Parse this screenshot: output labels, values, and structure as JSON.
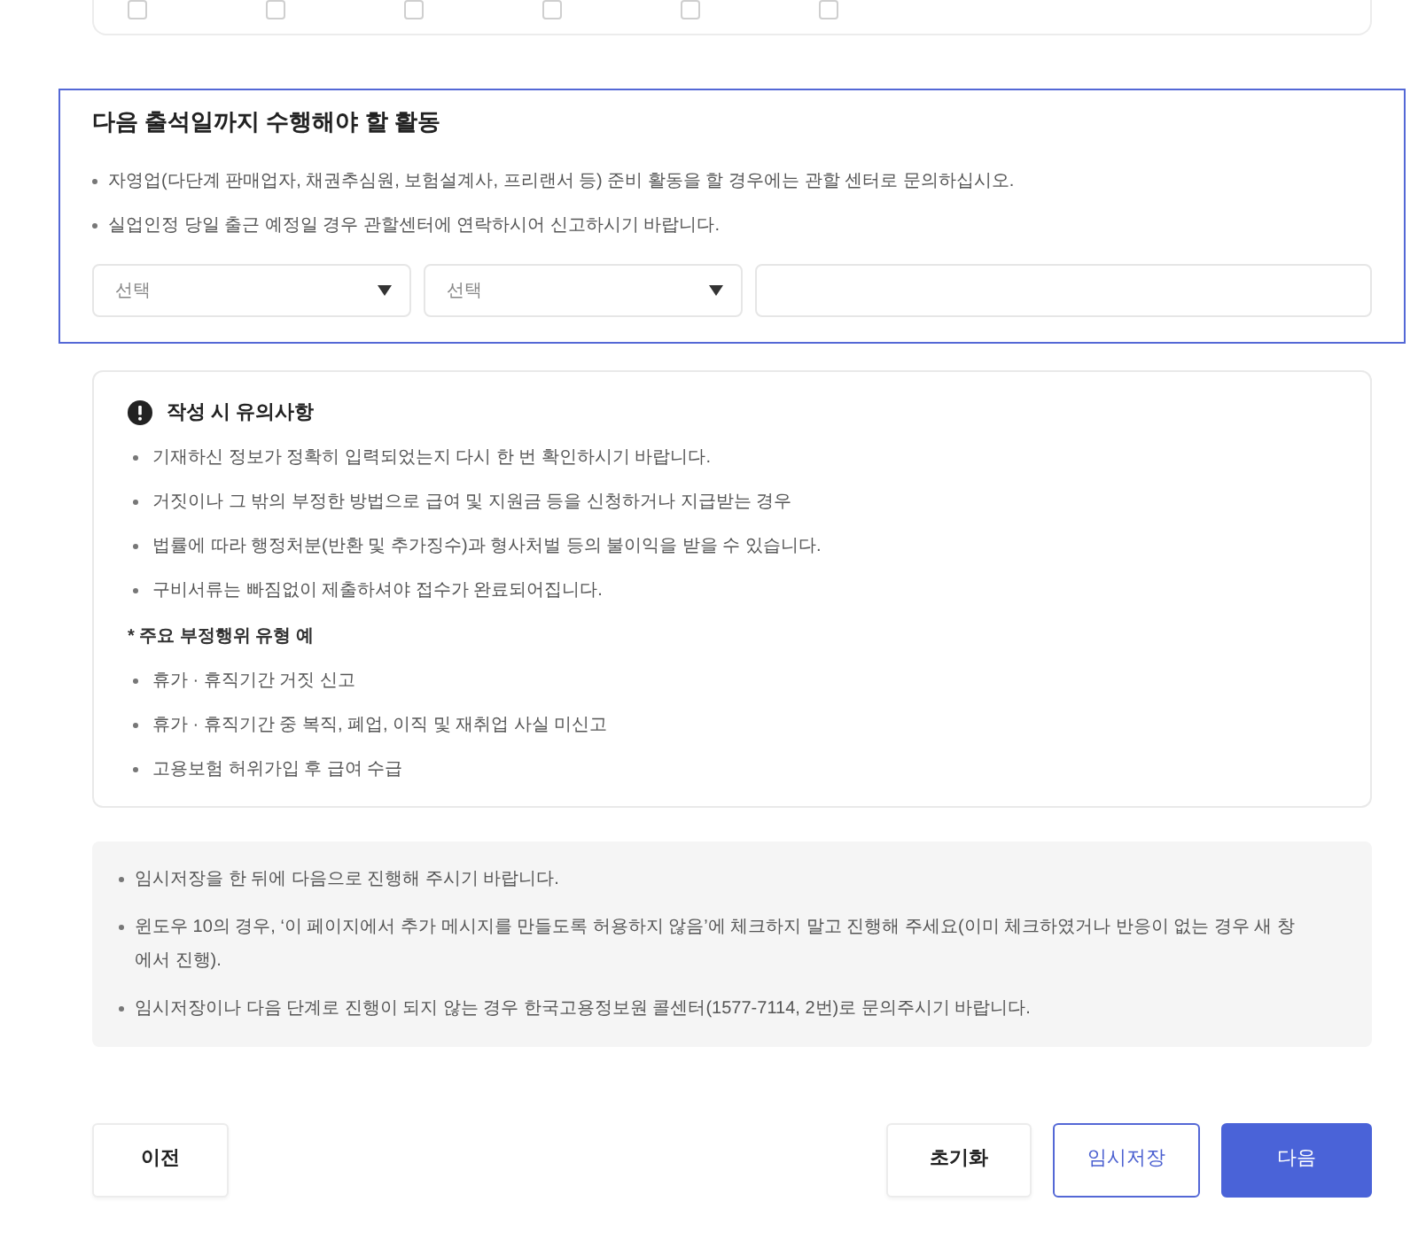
{
  "top_card": {
    "checkboxes": [
      {
        "checked": false
      },
      {
        "checked": false
      },
      {
        "checked": false
      },
      {
        "checked": false
      },
      {
        "checked": false
      },
      {
        "checked": false
      }
    ]
  },
  "activity_section": {
    "title": "다음 출석일까지 수행해야 할 활동",
    "notes": [
      "자영업(다단계 판매업자, 채권추심원, 보험설계사, 프리랜서 등) 준비 활동을 할 경우에는 관할 센터로 문의하십시오.",
      "실업인정 당일 출근 예정일 경우 관할센터에 연락하시어 신고하시기 바랍니다."
    ],
    "fields": [
      {
        "kind": "select",
        "placeholder": "선택"
      },
      {
        "kind": "select",
        "placeholder": "선택"
      },
      {
        "kind": "text"
      }
    ]
  },
  "caution": {
    "title": "작성 시 유의사항",
    "items": [
      {
        "kind": "bullet",
        "text": "기재하신 정보가 정확히 입력되었는지 다시 한 번 확인하시기 바랍니다."
      },
      {
        "kind": "bullet",
        "text": "거짓이나 그 밖의 부정한 방법으로 급여 및 지원금 등을 신청하거나 지급받는 경우"
      },
      {
        "kind": "bullet",
        "text": "법률에 따라 행정처분(반환 및 추가징수)과 형사처벌 등의 불이익을 받을 수 있습니다."
      },
      {
        "kind": "bullet",
        "text": "구비서류는 빠짐없이 제출하셔야 접수가 완료되어집니다."
      },
      {
        "kind": "heading",
        "text": "* 주요 부정행위 유형 예"
      },
      {
        "kind": "bullet",
        "text": "휴가 · 휴직기간 거짓 신고"
      },
      {
        "kind": "bullet",
        "text": "휴가 · 휴직기간 중 복직, 폐업, 이직 및 재취업 사실 미신고"
      },
      {
        "kind": "bullet",
        "text": "고용보험 허위가입 후 급여 수급"
      }
    ]
  },
  "info_notes": [
    "임시저장을 한 뒤에 다음으로 진행해 주시기 바랍니다.",
    "윈도우 10의 경우, ‘이 페이지에서 추가 메시지를 만들도록 허용하지 않음’에 체크하지 말고 진행해 주세요(이미 체크하였거나 반응이 없는 경우 새 창에서 진행).",
    "임시저장이나 다음 단계로 진행이 되지 않는 경우 한국고용정보원 콜센터(1577-7114, 2번)로 문의주시기 바랍니다."
  ],
  "buttons": {
    "left": [
      {
        "label": "이전",
        "kind": "default"
      }
    ],
    "right": [
      {
        "label": "초기화",
        "kind": "default"
      },
      {
        "label": "임시저장",
        "kind": "outline"
      },
      {
        "label": "다음",
        "kind": "primary"
      }
    ]
  }
}
